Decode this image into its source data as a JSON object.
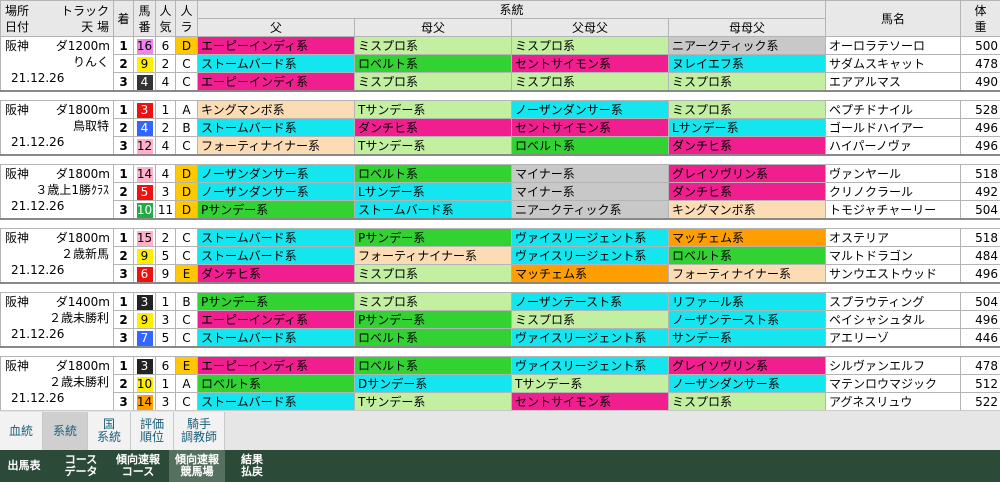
{
  "header": {
    "col_place": "場所",
    "col_date": "日付",
    "col_track": "トラック",
    "col_weather": "天 場",
    "col_finish": "着",
    "col_num_1": "馬",
    "col_num_2": "番",
    "col_pop_1": "人",
    "col_pop_2": "気",
    "col_tag_1": "人",
    "col_tag_2": "ラ",
    "col_lineage": "系統",
    "col_sire": "父",
    "col_dam_sire": "母父",
    "col_sire_dam_sire": "父母父",
    "col_dam_dam_sire": "母母父",
    "col_horse": "馬名",
    "col_weight_1": "体",
    "col_weight_2": "重"
  },
  "colors": {
    "エーピーインディ系": "#f01e8e",
    "ミスプロ系": "#c2f0a0",
    "ストームバード系": "#14e6f0",
    "ロベルト系": "#32d232",
    "セントサイモン系": "#f01e8e",
    "ニアークティック系": "#c8c8c8",
    "ヌレイエフ系": "#14e6f0",
    "キングマンボ系": "#fcdcb4",
    "Tサンデー系": "#c2f0a0",
    "ノーザンダンサー系": "#14e6f0",
    "ダンチヒ系": "#f01e8e",
    "Lサンデー系": "#14e6f0",
    "フォーティナイナー系": "#fcdcb4",
    "マイナー系": "#c8c8c8",
    "グレイソヴリン系": "#f01e8e",
    "Pサンデー系": "#32d232",
    "ヴァイスリージェント系": "#14e6f0",
    "マッチェム系": "#ff9e00",
    "ノーザンテースト系": "#14e6f0",
    "リファール系": "#14e6f0",
    "サンデー系": "#14e6f0",
    "Dサンデー系": "#14e6f0"
  },
  "tag_colors": {
    "A": "#ffffff",
    "B": "#ffffff",
    "C": "#ffffff",
    "D": "#ffc800",
    "E": "#ffc800"
  },
  "races": [
    {
      "place": "阪神",
      "track": "ダ1200m",
      "name": "りんく",
      "date": "21.12.26",
      "rows": [
        {
          "finish": "1",
          "num": "16",
          "num_bg": "#ee82ee",
          "num_fg": "#000000",
          "pop": "6",
          "tag": "D",
          "sire": "エーピーインディ系",
          "dam_sire": "ミスプロ系",
          "sire_dam_sire": "ミスプロ系",
          "dam_dam_sire": "ニアークティック系",
          "horse": "オーロラテソーロ",
          "weight": "500"
        },
        {
          "finish": "2",
          "num": "9",
          "num_bg": "#ffee00",
          "num_fg": "#000000",
          "pop": "2",
          "tag": "C",
          "sire": "ストームバード系",
          "dam_sire": "ロベルト系",
          "sire_dam_sire": "セントサイモン系",
          "dam_dam_sire": "ヌレイエフ系",
          "horse": "サダムスキャット",
          "weight": "478"
        },
        {
          "finish": "3",
          "num": "4",
          "num_bg": "#333333",
          "num_fg": "#ffffff",
          "pop": "4",
          "tag": "C",
          "sire": "エーピーインディ系",
          "dam_sire": "ミスプロ系",
          "sire_dam_sire": "ミスプロ系",
          "dam_dam_sire": "ミスプロ系",
          "horse": "エアアルマス",
          "weight": "490"
        }
      ]
    },
    {
      "place": "阪神",
      "track": "ダ1800m",
      "name": "鳥取特",
      "date": "21.12.26",
      "rows": [
        {
          "finish": "1",
          "num": "3",
          "num_bg": "#ee1111",
          "num_fg": "#ffffff",
          "pop": "1",
          "tag": "A",
          "sire": "キングマンボ系",
          "dam_sire": "Tサンデー系",
          "sire_dam_sire": "ノーザンダンサー系",
          "dam_dam_sire": "ミスプロ系",
          "horse": "ペプチドナイル",
          "weight": "528"
        },
        {
          "finish": "2",
          "num": "4",
          "num_bg": "#3366ff",
          "num_fg": "#ffffff",
          "pop": "2",
          "tag": "B",
          "sire": "ストームバード系",
          "dam_sire": "ダンチヒ系",
          "sire_dam_sire": "セントサイモン系",
          "dam_dam_sire": "Lサンデー系",
          "horse": "ゴールドハイアー",
          "weight": "496"
        },
        {
          "finish": "3",
          "num": "12",
          "num_bg": "#ffb0c8",
          "num_fg": "#000000",
          "pop": "4",
          "tag": "C",
          "sire": "フォーティナイナー系",
          "dam_sire": "Tサンデー系",
          "sire_dam_sire": "ロベルト系",
          "dam_dam_sire": "ダンチヒ系",
          "horse": "ハイパーノヴァ",
          "weight": "496"
        }
      ]
    },
    {
      "place": "阪神",
      "track": "ダ1800m",
      "name": "３歳上1勝ｸﾗｽ",
      "date": "21.12.26",
      "rows": [
        {
          "finish": "1",
          "num": "14",
          "num_bg": "#ffb0c8",
          "num_fg": "#000000",
          "pop": "4",
          "tag": "D",
          "sire": "ノーザンダンサー系",
          "dam_sire": "ロベルト系",
          "sire_dam_sire": "マイナー系",
          "dam_dam_sire": "グレイソヴリン系",
          "horse": "ヴァンヤール",
          "weight": "518"
        },
        {
          "finish": "2",
          "num": "5",
          "num_bg": "#ee1111",
          "num_fg": "#ffffff",
          "pop": "3",
          "tag": "D",
          "sire": "ノーザンダンサー系",
          "dam_sire": "Lサンデー系",
          "sire_dam_sire": "マイナー系",
          "dam_dam_sire": "ダンチヒ系",
          "horse": "クリノクラール",
          "weight": "492"
        },
        {
          "finish": "3",
          "num": "10",
          "num_bg": "#22aa44",
          "num_fg": "#ffffff",
          "pop": "11",
          "tag": "D",
          "sire": "Pサンデー系",
          "dam_sire": "ストームバード系",
          "sire_dam_sire": "ニアークティック系",
          "dam_dam_sire": "キングマンボ系",
          "horse": "トモジャチャーリー",
          "weight": "504"
        }
      ]
    },
    {
      "place": "阪神",
      "track": "ダ1800m",
      "name": "２歳新馬",
      "date": "21.12.26",
      "rows": [
        {
          "finish": "1",
          "num": "15",
          "num_bg": "#ffb0c8",
          "num_fg": "#000000",
          "pop": "2",
          "tag": "C",
          "sire": "ストームバード系",
          "dam_sire": "Pサンデー系",
          "sire_dam_sire": "ヴァイスリージェント系",
          "dam_dam_sire": "マッチェム系",
          "horse": "オステリア",
          "weight": "518"
        },
        {
          "finish": "2",
          "num": "9",
          "num_bg": "#ffee00",
          "num_fg": "#000000",
          "pop": "5",
          "tag": "C",
          "sire": "ストームバード系",
          "dam_sire": "フォーティナイナー系",
          "sire_dam_sire": "ヴァイスリージェント系",
          "dam_dam_sire": "ロベルト系",
          "horse": "マルトドラゴン",
          "weight": "484"
        },
        {
          "finish": "3",
          "num": "6",
          "num_bg": "#ee1111",
          "num_fg": "#ffffff",
          "pop": "9",
          "tag": "E",
          "sire": "ダンチヒ系",
          "dam_sire": "ミスプロ系",
          "sire_dam_sire": "マッチェム系",
          "dam_dam_sire": "フォーティナイナー系",
          "horse": "サンウエストウッド",
          "weight": "496"
        }
      ]
    },
    {
      "place": "阪神",
      "track": "ダ1400m",
      "name": "２歳未勝利",
      "date": "21.12.26",
      "rows": [
        {
          "finish": "1",
          "num": "3",
          "num_bg": "#222222",
          "num_fg": "#ffffff",
          "pop": "1",
          "tag": "B",
          "sire": "Pサンデー系",
          "dam_sire": "ミスプロ系",
          "sire_dam_sire": "ノーザンテースト系",
          "dam_dam_sire": "リファール系",
          "horse": "スプラウティング",
          "weight": "504"
        },
        {
          "finish": "2",
          "num": "9",
          "num_bg": "#ffee00",
          "num_fg": "#000000",
          "pop": "3",
          "tag": "C",
          "sire": "エーピーインディ系",
          "dam_sire": "Pサンデー系",
          "sire_dam_sire": "ミスプロ系",
          "dam_dam_sire": "ノーザンテースト系",
          "horse": "ペイシャシュタル",
          "weight": "496"
        },
        {
          "finish": "3",
          "num": "7",
          "num_bg": "#3366ff",
          "num_fg": "#ffffff",
          "pop": "5",
          "tag": "C",
          "sire": "ストームバード系",
          "dam_sire": "ロベルト系",
          "sire_dam_sire": "ヴァイスリージェント系",
          "dam_dam_sire": "サンデー系",
          "horse": "アエリーゾ",
          "weight": "446"
        }
      ]
    },
    {
      "place": "阪神",
      "track": "ダ1800m",
      "name": "２歳未勝利",
      "date": "21.12.26",
      "rows": [
        {
          "finish": "1",
          "num": "3",
          "num_bg": "#222222",
          "num_fg": "#ffffff",
          "pop": "6",
          "tag": "E",
          "sire": "エーピーインディ系",
          "dam_sire": "ロベルト系",
          "sire_dam_sire": "ヴァイスリージェント系",
          "dam_dam_sire": "グレイソヴリン系",
          "horse": "シルヴァンエルフ",
          "weight": "478"
        },
        {
          "finish": "2",
          "num": "10",
          "num_bg": "#ffee00",
          "num_fg": "#000000",
          "pop": "1",
          "tag": "A",
          "sire": "ロベルト系",
          "dam_sire": "Dサンデー系",
          "sire_dam_sire": "Tサンデー系",
          "dam_dam_sire": "ノーザンダンサー系",
          "horse": "マテンロウマジック",
          "weight": "512"
        },
        {
          "finish": "3",
          "num": "14",
          "num_bg": "#ff9e00",
          "num_fg": "#000000",
          "pop": "3",
          "tag": "C",
          "sire": "ストームバード系",
          "dam_sire": "Tサンデー系",
          "sire_dam_sire": "セントサイモン系",
          "dam_dam_sire": "ミスプロ系",
          "horse": "アグネスリュウ",
          "weight": "522"
        }
      ]
    }
  ],
  "tabs_primary": [
    {
      "label1": "血統",
      "label2": ""
    },
    {
      "label1": "系統",
      "label2": ""
    },
    {
      "label1": "国",
      "label2": "系統"
    },
    {
      "label1": "評価",
      "label2": "順位"
    },
    {
      "label1": "騎手",
      "label2": "調教師"
    }
  ],
  "tabs_primary_active": 1,
  "tabs_secondary": [
    {
      "label1": "出馬表",
      "label2": ""
    },
    {
      "label1": "コース",
      "label2": "データ"
    },
    {
      "label1": "傾向速報",
      "label2": "コース"
    },
    {
      "label1": "傾向速報",
      "label2": "競馬場"
    },
    {
      "label1": "結果",
      "label2": "払戻"
    }
  ],
  "tabs_secondary_active": 3
}
